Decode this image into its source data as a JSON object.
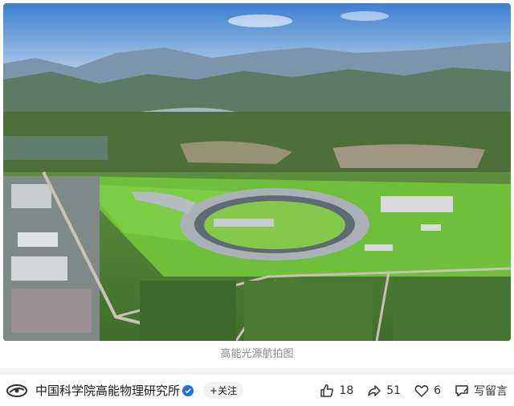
{
  "photo": {
    "alt_icon": "aerial-photo-image"
  },
  "caption": "高能光源航拍图",
  "author": {
    "name": "中国科学院高能物理研究所",
    "follow_label": "+关注"
  },
  "actions": {
    "like_count": "18",
    "share_count": "51",
    "favorite_count": "6",
    "comment_label": "写留言"
  },
  "colors": {
    "accent": "#1e6fe0",
    "caption": "#8a8a8a"
  }
}
